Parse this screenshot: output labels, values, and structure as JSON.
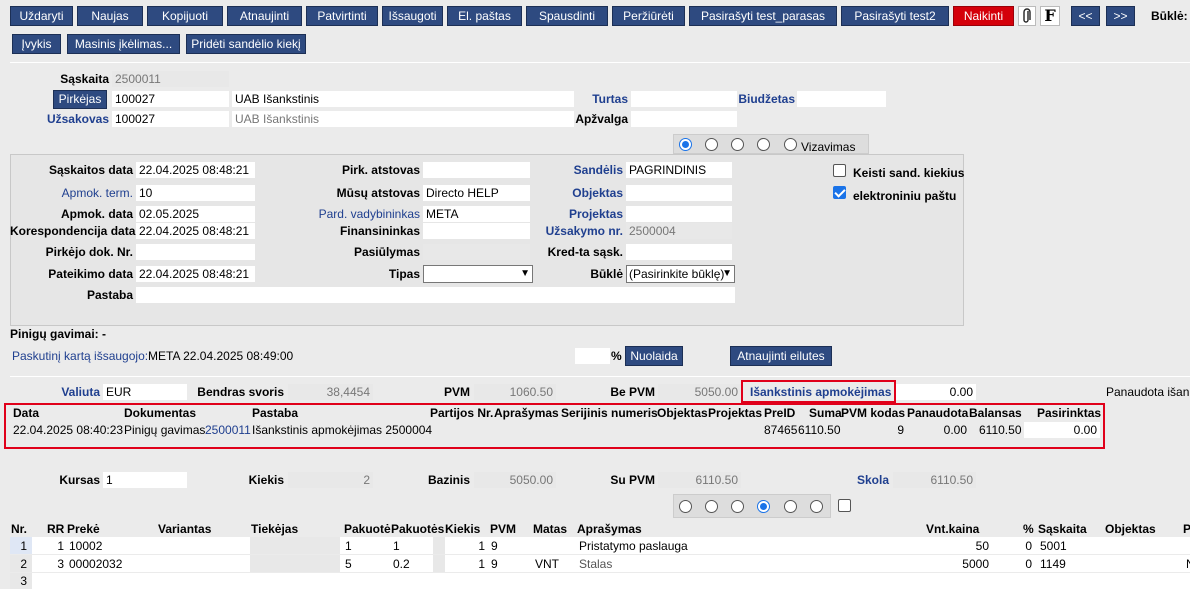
{
  "toolbar": {
    "buttons": [
      "Uždaryti",
      "Naujas",
      "Kopijuoti",
      "Atnaujinti",
      "Patvirtinti",
      "Išsaugoti",
      "El. paštas",
      "Spausdinti",
      "Peržiūrėti",
      "Pasirašyti test_parasas",
      "Pasirašyti test2",
      "Naikinti"
    ],
    "f_label": "F",
    "prev": "<<",
    "next": ">>",
    "status_label": "Būklė:",
    "row2": [
      "Įvykis",
      "Masinis įkėlimas...",
      "Pridėti sandėlio kiekį"
    ]
  },
  "header": {
    "saskaita_label": "Sąskaita",
    "saskaita": "2500011",
    "pirkejas_btn": "Pirkėjas",
    "pirkejas_code": "100027",
    "pirkejas_name": "UAB Išankstinis",
    "uzsakovas_label": "Užsakovas",
    "uzsakovas_code": "100027",
    "uzsakovas_name": "UAB Išankstinis",
    "turtas_label": "Turtas",
    "biudzetas_label": "Biudžetas",
    "apzvalga_label": "Apžvalga",
    "vizavimas": "Vizavimas"
  },
  "form": {
    "saskaitos_data_label": "Sąskaitos data",
    "saskaitos_data": "22.04.2025 08:48:21",
    "apmok_term_label": "Apmok. term.",
    "apmok_term": "10",
    "apmok_data_label": "Apmok. data",
    "apmok_data": "02.05.2025",
    "koresp_label": "Korespondencija data",
    "koresp": "22.04.2025 08:48:21",
    "pirk_dok_label": "Pirkėjo dok. Nr.",
    "pateikimo_label": "Pateikimo data",
    "pateikimo": "22.04.2025 08:48:21",
    "pastaba_label": "Pastaba",
    "pirk_atstovas_label": "Pirk. atstovas",
    "musu_atstovas_label": "Mūsų atstovas",
    "musu_atstovas": "Directo HELP",
    "pard_vadyb_label": "Pard. vadybininkas",
    "pard_vadyb": "META",
    "finansininkas_label": "Finansininkas",
    "pasiulymas_label": "Pasiūlymas",
    "tipas_label": "Tipas",
    "sandelis_label": "Sandėlis",
    "sandelis": "PAGRINDINIS",
    "objektas_label": "Objektas",
    "projektas_label": "Projektas",
    "uzsakymo_label": "Užsakymo nr.",
    "uzsakymo": "2500004",
    "kred_label": "Kred-ta sąsk.",
    "bukle_label": "Būklė",
    "bukle": "(Pasirinkite būklę)",
    "keisti_label": "Keisti sand. kiekius",
    "el_pastu_label": "elektroniniu paštu"
  },
  "payments": {
    "gavimai_label": "Pinigų gavimai: -",
    "last_saved_label": "Paskutinį kartą išsaugojo:",
    "last_saved": "META 22.04.2025 08:49:00",
    "percent": "%",
    "nuolaida_btn": "Nuolaida",
    "atnaujinti_btn": "Atnaujinti eilutes"
  },
  "totals": {
    "valiuta_label": "Valiuta",
    "valiuta": "EUR",
    "svoris_label": "Bendras svoris",
    "svoris": "38,4454",
    "pvm_label": "PVM",
    "pvm": "1060.50",
    "be_pvm_label": "Be PVM",
    "be_pvm": "5050.00",
    "isank_label": "Išankstinis apmokėjimas",
    "isank": "0.00",
    "panaudota_label": "Panaudota išanl"
  },
  "prepay_table": {
    "headers": [
      "Data",
      "Dokumentas",
      "Pastaba",
      "Partijos Nr.",
      "Aprašymas",
      "Serijinis numeris",
      "Objektas",
      "Projektas",
      "PreID",
      "Suma",
      "PVM kodas",
      "Panaudota",
      "Balansas",
      "Pasirinktas"
    ],
    "row": {
      "data": "22.04.2025 08:40:23",
      "dok": "Pinigų gavimas",
      "dok_link": "2500011",
      "pastaba": "Išankstinis apmokėjimas 2500004",
      "preid": "87465",
      "suma": "6110.50",
      "pvm_kodas": "9",
      "panaudota": "0.00",
      "balansas": "6110.50",
      "pasirinktas": "0.00"
    }
  },
  "summary": {
    "kursas_label": "Kursas",
    "kursas": "1",
    "kiekis_label": "Kiekis",
    "kiekis": "2",
    "bazinis_label": "Bazinis",
    "bazinis": "5050.00",
    "su_pvm_label": "Su PVM",
    "su_pvm": "6110.50",
    "skola_label": "Skola",
    "skola": "6110.50"
  },
  "rows_table": {
    "headers": [
      "Nr.",
      "RR",
      "Prekė",
      "Variantas",
      "Tiekėjas",
      "Pakuotė",
      "Pakuotės",
      "Kiekis",
      "PVM",
      "Matas",
      "Aprašymas",
      "Vnt.kaina",
      "%",
      "Sąskaita",
      "Objektas",
      "P"
    ],
    "rows": [
      {
        "nr": "1",
        "rr": "1",
        "preke": "10002",
        "pak1": "1",
        "pak2": "1",
        "kiekis": "1",
        "pvm": "9",
        "matas": "",
        "apr": "Pristatymo paslauga",
        "kaina": "50",
        "pct": "0",
        "sask": "5001"
      },
      {
        "nr": "2",
        "rr": "3",
        "preke": "00002032",
        "pak1": "5",
        "pak2": "0.2",
        "kiekis": "1",
        "pvm": "9",
        "matas": "VNT",
        "apr": "Stalas",
        "kaina": "5000",
        "pct": "0",
        "sask": "1149"
      },
      {
        "nr": "3",
        "rr": "",
        "preke": "",
        "pak1": "",
        "pak2": "",
        "kiekis": "",
        "pvm": "",
        "matas": "",
        "apr": "",
        "kaina": "",
        "pct": "",
        "sask": ""
      }
    ]
  }
}
